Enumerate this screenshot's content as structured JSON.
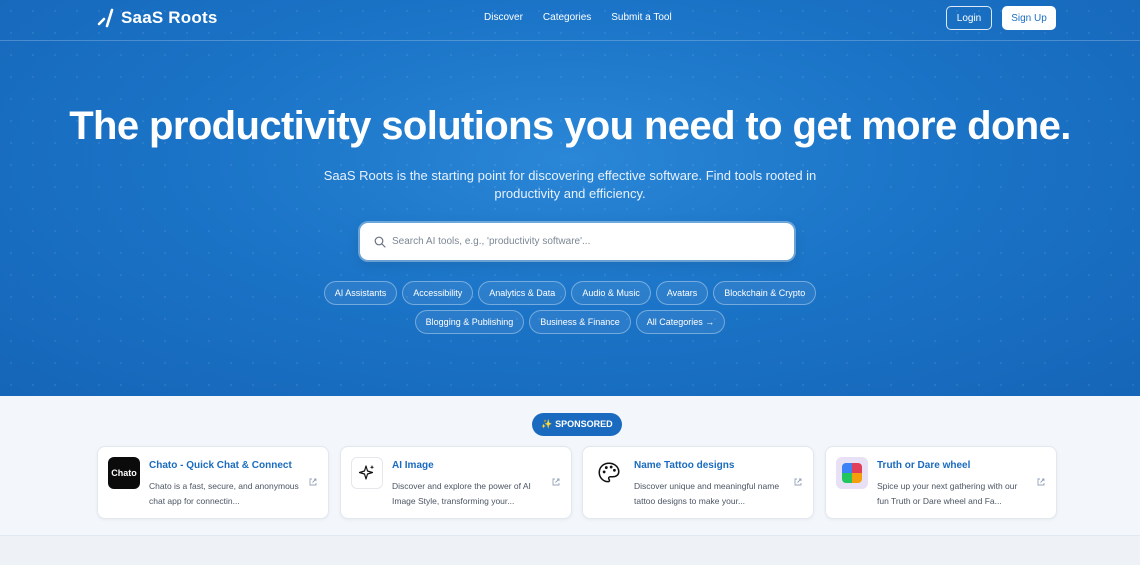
{
  "brand": {
    "name": "SaaS Roots"
  },
  "nav": {
    "links": [
      "Discover",
      "Categories",
      "Submit a Tool"
    ],
    "login": "Login",
    "signup": "Sign Up"
  },
  "hero": {
    "headline": "The productivity solutions you need to get more done.",
    "subtitle": "SaaS Roots is the starting point for discovering effective software. Find tools rooted in productivity and efficiency.",
    "search_placeholder": "Search AI tools, e.g., 'productivity software'..."
  },
  "categories": {
    "row1": [
      "AI Assistants",
      "Accessibility",
      "Analytics & Data",
      "Audio & Music",
      "Avatars",
      "Blockchain & Crypto"
    ],
    "row2": [
      "Blogging & Publishing",
      "Business & Finance",
      "All Categories →"
    ]
  },
  "sponsored": {
    "label": "✨ SPONSORED"
  },
  "cards": [
    {
      "title": "Chato - Quick Chat & Connect",
      "desc": "Chato is a fast, secure, and anonymous chat app for connectin...",
      "logo_text": "Chato"
    },
    {
      "title": "AI Image",
      "desc": "Discover and explore the power of AI Image Style, transforming your..."
    },
    {
      "title": "Name Tattoo designs",
      "desc": "Discover unique and meaningful name tattoo designs to make your..."
    },
    {
      "title": "Truth or Dare wheel",
      "desc": "Spice up your next gathering with our fun Truth or Dare wheel and Fa..."
    }
  ],
  "colors": {
    "hero": "#1b74c7",
    "accent": "#1a6bbf",
    "white": "#ffffff"
  }
}
